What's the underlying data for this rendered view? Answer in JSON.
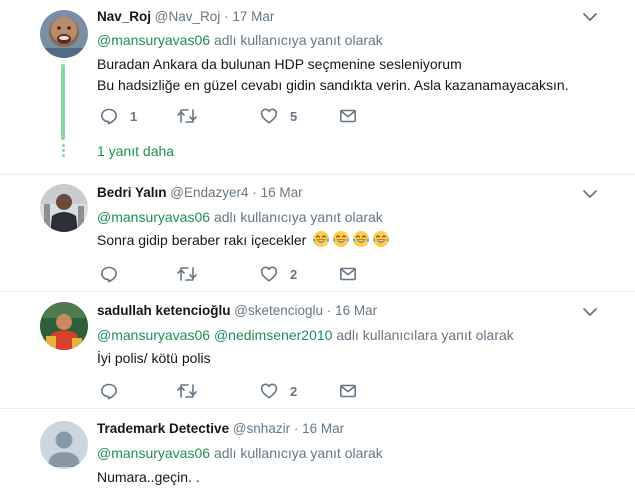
{
  "tweets": [
    {
      "fullname": "Nav_Roj",
      "handle": "@Nav_Roj",
      "dot": "·",
      "date": "17 Mar",
      "reply_mentions": [
        "@mansuryavas06"
      ],
      "reply_suffix": "adlı kullanıcıya yanıt olarak",
      "lines": [
        "Buradan Ankara da bulunan HDP seçmenine sesleniyorum",
        "Bu hadsizliğe en güzel cevabı gidin sandıkta verin. Asla kazanamayacaksın."
      ],
      "reply_count": "1",
      "retweet_count": "",
      "like_count": "5",
      "more_replies": "1 yanıt daha"
    },
    {
      "fullname": "Bedri Yalın",
      "handle": "@Endazyer4",
      "dot": "·",
      "date": "16 Mar",
      "reply_mentions": [
        "@mansuryavas06"
      ],
      "reply_suffix": "adlı kullanıcıya yanıt olarak",
      "lines": [
        "Sonra gidip beraber rakı içecekler"
      ],
      "emoji_count": 4,
      "reply_count": "",
      "retweet_count": "",
      "like_count": "2"
    },
    {
      "fullname": "sadullah ketencioğlu",
      "handle": "@sketencioglu",
      "dot": "·",
      "date": "16 Mar",
      "reply_mentions": [
        "@mansuryavas06",
        "@nedimsener2010"
      ],
      "reply_suffix": "adlı kullanıcılara yanıt olarak",
      "lines": [
        "İyi polis/ kötü polis"
      ],
      "reply_count": "",
      "retweet_count": "",
      "like_count": "2"
    },
    {
      "fullname": "Trademark Detective",
      "handle": "@snhazir",
      "dot": "·",
      "date": "16 Mar",
      "reply_mentions": [
        "@mansuryavas06"
      ],
      "reply_suffix": "adlı kullanıcıya yanıt olarak",
      "lines": [
        "Numara..geçin. ."
      ]
    }
  ],
  "icons": {
    "reply": "reply-icon",
    "retweet": "retweet-icon",
    "like": "heart-icon",
    "dm": "envelope-icon",
    "caret": "chevron-down-icon",
    "emoji": "laughing-tears-emoji"
  },
  "colors": {
    "accent": "#1b9151",
    "thread": "#8fd4a8",
    "muted": "#657786",
    "border": "#e6ecf0"
  }
}
